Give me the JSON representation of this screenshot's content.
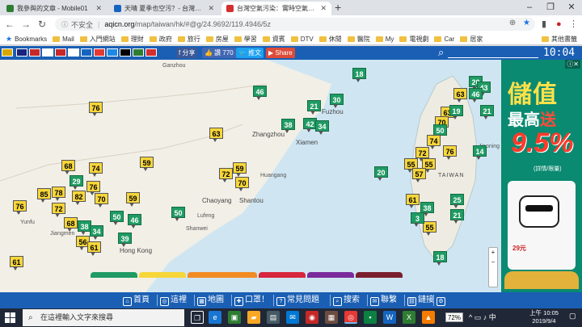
{
  "browser": {
    "tabs": [
      {
        "title": "我參與的文章 - Mobile01",
        "icon_color": "#2e7d32",
        "active": false
      },
      {
        "title": "天晴 夏季也空污？- 台灣新聞(",
        "icon_color": "#1565c0",
        "active": false
      },
      {
        "title": "台灣空氣污染：實時空氣質量指",
        "icon_color": "#d32f2f",
        "active": true
      }
    ],
    "new_tab_symbol": "+",
    "window_controls": [
      "–",
      "❐",
      "✕"
    ],
    "address": {
      "insecure_label": "不安全",
      "domain": "aqicn.org",
      "path": "/map/taiwan/hk/#@g/24.9692/119.4946/5z"
    },
    "bookmarks": [
      {
        "label": "Bookmarks",
        "type": "star"
      },
      {
        "label": "Mail",
        "type": "folder"
      },
      {
        "label": "入門網站",
        "type": "folder"
      },
      {
        "label": "理財",
        "type": "folder"
      },
      {
        "label": "政府",
        "type": "folder"
      },
      {
        "label": "旅行",
        "type": "folder"
      },
      {
        "label": "房屋",
        "type": "folder"
      },
      {
        "label": "學習",
        "type": "folder"
      },
      {
        "label": "資賓",
        "type": "folder"
      },
      {
        "label": "DTV",
        "type": "folder"
      },
      {
        "label": "休閒",
        "type": "folder"
      },
      {
        "label": "醫院",
        "type": "folder"
      },
      {
        "label": "My",
        "type": "folder"
      },
      {
        "label": "電視劇",
        "type": "folder"
      },
      {
        "label": "Car",
        "type": "folder"
      },
      {
        "label": "居家",
        "type": "folder"
      },
      {
        "label": "其他書籤",
        "type": "folder"
      }
    ]
  },
  "site": {
    "share_buttons": [
      {
        "label": "f 分享",
        "color": "#3b5998"
      },
      {
        "label": "👍 讚 770",
        "color": "#4267b2"
      },
      {
        "label": "🐦 推文",
        "color": "#1da1f2"
      },
      {
        "label": "▶ Share",
        "color": "#dd4b39"
      }
    ],
    "flag_colors": [
      "#d9a800",
      "#c62828",
      "#1a237e",
      "#c62828",
      "#ffffff",
      "#1565c0",
      "#c62828",
      "#e53935",
      "#1e88e5",
      "#d32f2f",
      "#000000",
      "#2e7d32",
      "#d32f2f"
    ],
    "clock": "10:04"
  },
  "map": {
    "places": [
      {
        "name": "Ganzhou",
        "big": false
      },
      {
        "name": "Fuzhou",
        "big": true
      },
      {
        "name": "Zhangzhou",
        "big": true
      },
      {
        "name": "Xiamen",
        "big": true
      },
      {
        "name": "Huangang",
        "big": false
      },
      {
        "name": "Chaoyang",
        "big": true
      },
      {
        "name": "Shantou",
        "big": true
      },
      {
        "name": "Shanwei",
        "big": false
      },
      {
        "name": "Lufeng",
        "big": false
      },
      {
        "name": "Hong Kong",
        "big": true
      },
      {
        "name": "Yunfu",
        "big": false
      },
      {
        "name": "Jiangmen",
        "big": false
      },
      {
        "name": "TAIWAN",
        "big": true
      },
      {
        "name": "Jiaoning",
        "big": false
      }
    ],
    "markers": [
      {
        "v": 18,
        "level": "good"
      },
      {
        "v": 46,
        "level": "good"
      },
      {
        "v": 76,
        "level": "mod"
      },
      {
        "v": 21,
        "level": "good"
      },
      {
        "v": 30,
        "level": "good"
      },
      {
        "v": 38,
        "level": "good"
      },
      {
        "v": 42,
        "level": "good"
      },
      {
        "v": 34,
        "level": "good"
      },
      {
        "v": 63,
        "level": "mod"
      },
      {
        "v": 20,
        "level": "good"
      },
      {
        "v": 43,
        "level": "good"
      },
      {
        "v": 63,
        "level": "mod"
      },
      {
        "v": 46,
        "level": "good"
      },
      {
        "v": 63,
        "level": "mod"
      },
      {
        "v": 19,
        "level": "good"
      },
      {
        "v": 21,
        "level": "good"
      },
      {
        "v": 70,
        "level": "mod"
      },
      {
        "v": 50,
        "level": "good"
      },
      {
        "v": 74,
        "level": "mod"
      },
      {
        "v": 72,
        "level": "mod"
      },
      {
        "v": 76,
        "level": "mod"
      },
      {
        "v": 14,
        "level": "good"
      },
      {
        "v": 59,
        "level": "mod"
      },
      {
        "v": 68,
        "level": "mod"
      },
      {
        "v": 74,
        "level": "mod"
      },
      {
        "v": 29,
        "level": "good"
      },
      {
        "v": 72,
        "level": "mod"
      },
      {
        "v": 59,
        "level": "mod"
      },
      {
        "v": 70,
        "level": "mod"
      },
      {
        "v": 55,
        "level": "mod"
      },
      {
        "v": 55,
        "level": "mod"
      },
      {
        "v": 57,
        "level": "mod"
      },
      {
        "v": 20,
        "level": "good"
      },
      {
        "v": 85,
        "level": "mod"
      },
      {
        "v": 78,
        "level": "mod"
      },
      {
        "v": 82,
        "level": "mod"
      },
      {
        "v": 76,
        "level": "mod"
      },
      {
        "v": 70,
        "level": "mod"
      },
      {
        "v": 59,
        "level": "mod"
      },
      {
        "v": 50,
        "level": "good"
      },
      {
        "v": 76,
        "level": "mod"
      },
      {
        "v": 72,
        "level": "mod"
      },
      {
        "v": 61,
        "level": "mod"
      },
      {
        "v": 25,
        "level": "good"
      },
      {
        "v": 38,
        "level": "good"
      },
      {
        "v": 50,
        "level": "good"
      },
      {
        "v": 46,
        "level": "good"
      },
      {
        "v": 68,
        "level": "mod"
      },
      {
        "v": 38,
        "level": "good"
      },
      {
        "v": 34,
        "level": "good"
      },
      {
        "v": 39,
        "level": "good"
      },
      {
        "v": 56,
        "level": "mod"
      },
      {
        "v": 61,
        "level": "mod"
      },
      {
        "v": 55,
        "level": "mod"
      },
      {
        "v": 21,
        "level": "good"
      },
      {
        "v": 3,
        "level": "good"
      },
      {
        "v": 18,
        "level": "good"
      },
      {
        "v": 61,
        "level": "mod"
      }
    ],
    "scale_colors": [
      "#1f9b63",
      "#f7d63a",
      "#f28b24",
      "#d7263d",
      "#7b2b9b",
      "#7a1f2d"
    ]
  },
  "ad": {
    "headline": "儲值",
    "subline_a": "最高",
    "subline_b": "送",
    "percent": "9.5%",
    "note": "(詳情/限量)",
    "brand": "29元"
  },
  "bottom_nav": [
    {
      "label": "首頁",
      "icon": "⌂"
    },
    {
      "label": "這裡",
      "icon": "◎"
    },
    {
      "label": "地圖",
      "icon": "▦"
    },
    {
      "label": "口罩！",
      "icon": "✚"
    },
    {
      "label": "常見問題",
      "icon": "?"
    },
    {
      "label": "搜索",
      "icon": "⌕"
    },
    {
      "label": "聯繫",
      "icon": "✉"
    },
    {
      "label": "鏈接",
      "icon": "⛓"
    },
    {
      "label": "",
      "icon": "⚙"
    }
  ],
  "taskbar": {
    "search_placeholder": "在這裡輸入文字來搜尋",
    "aqi_badge": "72%",
    "time": "上午 10:05",
    "date": "2019/9/4",
    "tray_symbols": "^ ▭ ♪ 中"
  }
}
